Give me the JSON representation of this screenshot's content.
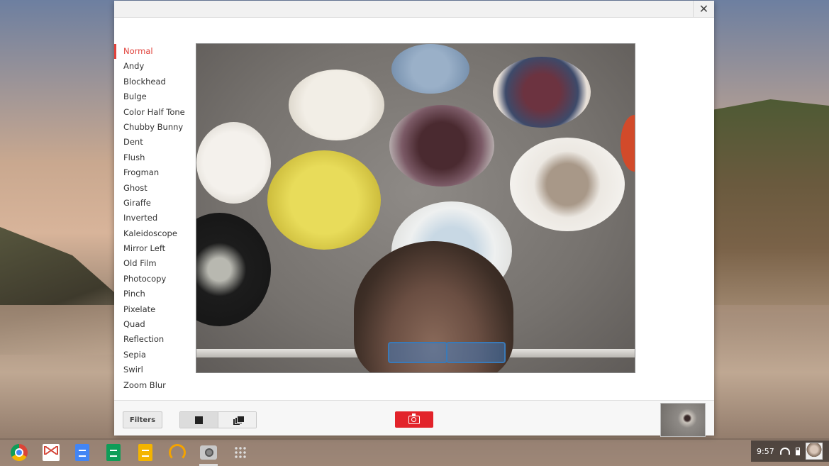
{
  "window": {
    "close_symbol": "✕"
  },
  "filters": [
    {
      "label": "Normal",
      "active": true
    },
    {
      "label": "Andy"
    },
    {
      "label": "Blockhead"
    },
    {
      "label": "Bulge"
    },
    {
      "label": "Color Half Tone"
    },
    {
      "label": "Chubby Bunny"
    },
    {
      "label": "Dent"
    },
    {
      "label": "Flush"
    },
    {
      "label": "Frogman"
    },
    {
      "label": "Ghost"
    },
    {
      "label": "Giraffe"
    },
    {
      "label": "Inverted"
    },
    {
      "label": "Kaleidoscope"
    },
    {
      "label": "Mirror Left"
    },
    {
      "label": "Old Film"
    },
    {
      "label": "Photocopy"
    },
    {
      "label": "Pinch"
    },
    {
      "label": "Pixelate"
    },
    {
      "label": "Quad"
    },
    {
      "label": "Reflection"
    },
    {
      "label": "Sepia"
    },
    {
      "label": "Swirl"
    },
    {
      "label": "Zoom Blur"
    }
  ],
  "bottombar": {
    "filters_button": "Filters",
    "modes": [
      "single-shot-icon",
      "multi-shot-icon"
    ],
    "shutter_icon": "camera-icon"
  },
  "shelf": {
    "apps": [
      "chrome-icon",
      "gmail-icon",
      "docs-icon",
      "sheets-icon",
      "slides-icon",
      "play-music-icon",
      "camera-icon",
      "app-launcher-icon"
    ]
  },
  "tray": {
    "time": "9:57"
  },
  "colors": {
    "accent": "#e0413a",
    "shutter": "#e2232a"
  }
}
